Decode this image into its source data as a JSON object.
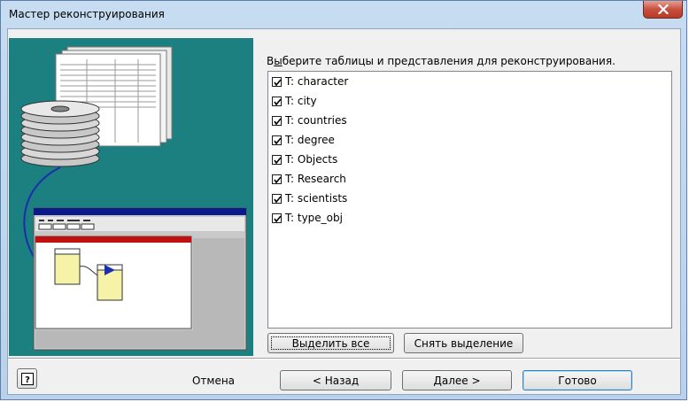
{
  "window": {
    "title": "Мастер реконструирования"
  },
  "main": {
    "prompt_prefix": "В",
    "prompt_underlined": "ы",
    "prompt_rest": "берите таблицы и представления для реконструирования.",
    "tables": [
      {
        "label": "T: character",
        "checked": true
      },
      {
        "label": "T: city",
        "checked": true
      },
      {
        "label": "T: countries",
        "checked": true
      },
      {
        "label": "T: degree",
        "checked": true
      },
      {
        "label": "T: Objects",
        "checked": true
      },
      {
        "label": "T: Research",
        "checked": true
      },
      {
        "label": "T: scientists",
        "checked": true
      },
      {
        "label": "T: type_obj",
        "checked": true
      }
    ],
    "select_all_label": "Выделить все",
    "deselect_label": "Снять выделение"
  },
  "footer": {
    "help_label": "?",
    "cancel_label": "Отмена",
    "back_label": "< Назад",
    "next_label": "Далее >",
    "finish_label": "Готово"
  },
  "colors": {
    "art_background": "#1c7f80",
    "window_frame": "#b9d1ea",
    "close_button": "#c75040"
  }
}
